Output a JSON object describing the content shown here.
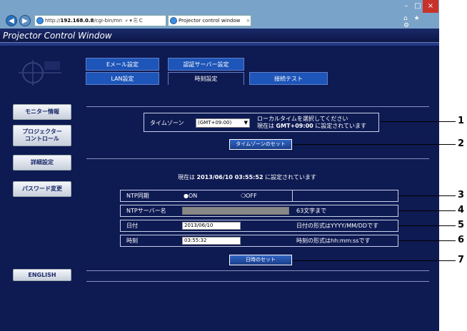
{
  "browser": {
    "url_prefix": "http://",
    "url_host": "192.168.0.8",
    "url_rest": "/cgi-bin/mn",
    "url_icons": "⌕ ▾ ⎘ C",
    "tab_title": "Projector control window",
    "tab_close": "×",
    "window_minimize": "–",
    "window_maximize": "□",
    "window_close": "×",
    "right_icons": "⌂ ★ ⚙"
  },
  "app": {
    "title": "Projector Control Window"
  },
  "sidebar": {
    "items": [
      {
        "label": "モニター情報"
      },
      {
        "label": "プロジェクター\nコントロール"
      },
      {
        "label": "詳細設定"
      },
      {
        "label": "パスワード変更"
      },
      {
        "label": "ENGLISH"
      }
    ]
  },
  "tabs": {
    "row1": [
      "Eメール設定",
      "認証サーバー設定"
    ],
    "row2": [
      "LAN設定",
      "時刻設定",
      "接続テスト"
    ]
  },
  "timezone": {
    "label": "タイムゾーン",
    "selected": "(GMT+09:00)",
    "note_line1": "ローカルタイムを選択してください",
    "note_line2_pre": "現在は ",
    "note_line2_val": "GMT+09:00",
    "note_line2_post": " に設定されています",
    "set_button": "タイムゾーンのセット"
  },
  "status": {
    "pre": "現在は ",
    "value": "2013/06/10 03:55:52",
    "post": " に設定されています"
  },
  "ntp": {
    "sync_label": "NTP同期",
    "on_label": "ON",
    "off_label": "OFF",
    "selected": "off",
    "server_label": "NTPサーバー名",
    "server_hint": "63文字まで"
  },
  "date": {
    "label": "日付",
    "value": "2013/06/10",
    "hint": "日付の形式はYYYY/MM/DDです"
  },
  "time": {
    "label": "時刻",
    "value": "03:55:32",
    "hint": "時刻の形式はhh:mm:ssです"
  },
  "datetime_button": "日時のセット",
  "callouts": [
    "1",
    "2",
    "3",
    "4",
    "5",
    "6",
    "7"
  ]
}
